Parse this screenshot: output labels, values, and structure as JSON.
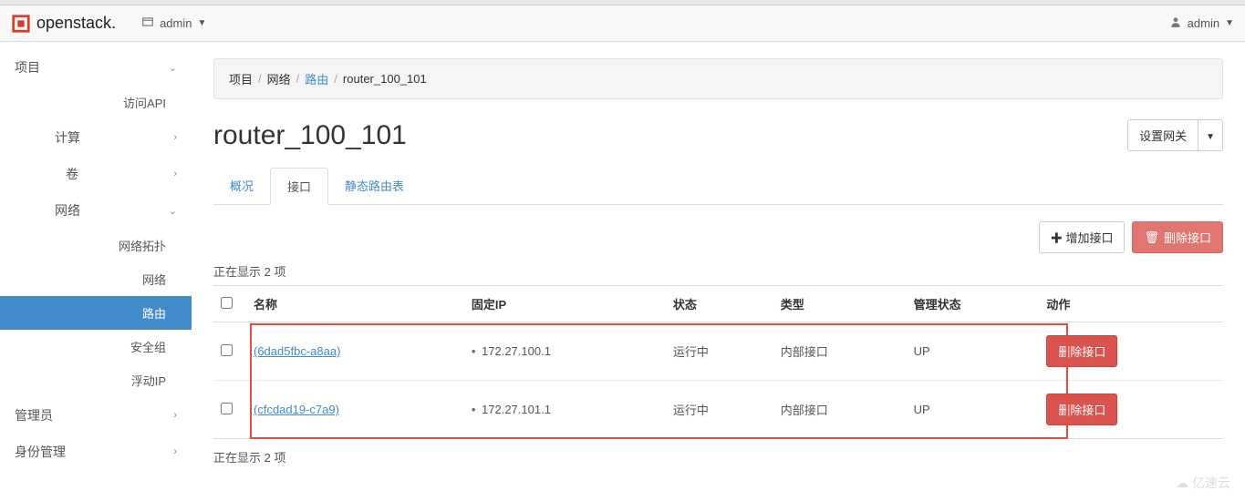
{
  "brand": "openstack",
  "context": {
    "project": "admin"
  },
  "user": {
    "name": "admin"
  },
  "sidebar": {
    "project_label": "项目",
    "access_api": "访问API",
    "compute": "计算",
    "volume": "卷",
    "network": "网络",
    "network_topo": "网络拓扑",
    "network_item": "网络",
    "router": "路由",
    "security_group": "安全组",
    "floating_ip": "浮动IP",
    "admin": "管理员",
    "identity": "身份管理"
  },
  "breadcrumb": {
    "project": "项目",
    "network": "网络",
    "routers": "路由",
    "current": "router_100_101"
  },
  "page": {
    "title": "router_100_101",
    "set_gateway": "设置网关"
  },
  "tabs": {
    "overview": "概况",
    "interfaces": "接口",
    "static_routes": "静态路由表"
  },
  "buttons": {
    "add_iface": "增加接口",
    "del_iface": "删除接口"
  },
  "table": {
    "caption_top": "正在显示 2 项",
    "caption_bottom": "正在显示 2 项",
    "headers": {
      "name": "名称",
      "fixed_ip": "固定IP",
      "status": "状态",
      "type": "类型",
      "admin_state": "管理状态",
      "actions": "动作"
    },
    "rows": [
      {
        "name": "(6dad5fbc-a8aa)",
        "ip": "172.27.100.1",
        "status": "运行中",
        "type": "内部接口",
        "admin_state": "UP",
        "action": "删除接口"
      },
      {
        "name": "(cfcdad19-c7a9)",
        "ip": "172.27.101.1",
        "status": "运行中",
        "type": "内部接口",
        "admin_state": "UP",
        "action": "删除接口"
      }
    ]
  },
  "watermark": "亿速云"
}
